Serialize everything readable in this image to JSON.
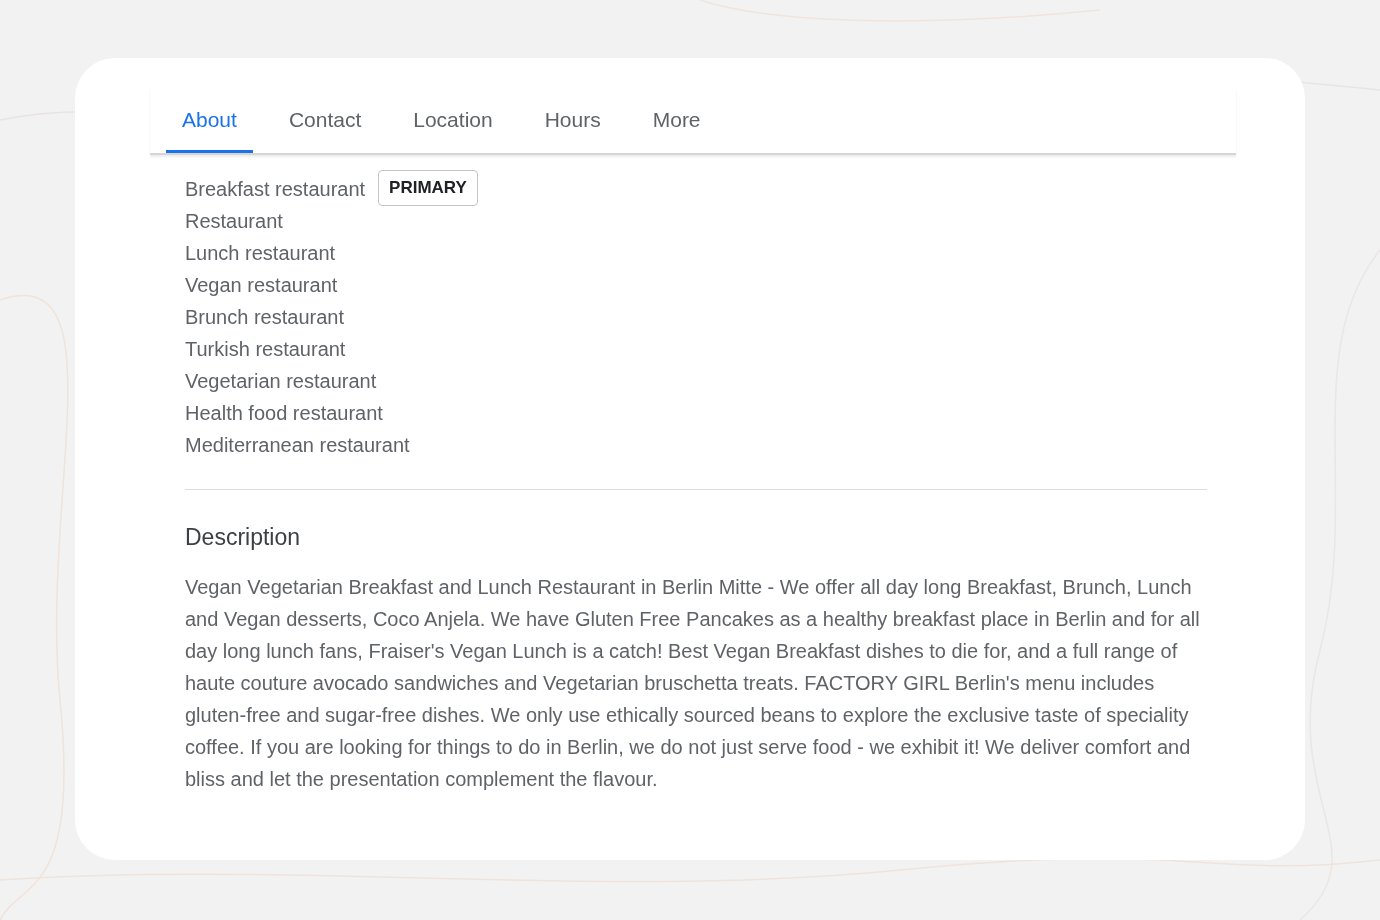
{
  "tabs": [
    {
      "label": "About",
      "selected": true
    },
    {
      "label": "Contact",
      "selected": false
    },
    {
      "label": "Location",
      "selected": false
    },
    {
      "label": "Hours",
      "selected": false
    },
    {
      "label": "More",
      "selected": false
    }
  ],
  "categories": [
    {
      "name": "Breakfast restaurant",
      "badge": "PRIMARY"
    },
    {
      "name": "Restaurant"
    },
    {
      "name": "Lunch restaurant"
    },
    {
      "name": "Vegan restaurant"
    },
    {
      "name": "Brunch restaurant"
    },
    {
      "name": "Turkish restaurant"
    },
    {
      "name": "Vegetarian restaurant"
    },
    {
      "name": "Health food restaurant"
    },
    {
      "name": "Mediterranean restaurant"
    }
  ],
  "description": {
    "heading": "Description",
    "text": "Vegan Vegetarian Breakfast and Lunch Restaurant in Berlin Mitte - We offer all day long Breakfast, Brunch, Lunch and Vegan desserts, Coco Anjela. We have Gluten Free Pancakes as a healthy breakfast place in Berlin and for all day long lunch fans, Fraiser's Vegan Lunch is a catch! Best Vegan Breakfast dishes to die for, and a full range of haute couture avocado sandwiches and Vegetarian bruschetta treats. FACTORY GIRL Berlin's menu includes gluten-free and sugar-free dishes. We only use ethically sourced beans to explore the exclusive taste of speciality coffee. If you are looking for things to do in Berlin, we do not just serve food - we exhibit it! We deliver comfort and bliss and let the presentation complement the flavour."
  }
}
